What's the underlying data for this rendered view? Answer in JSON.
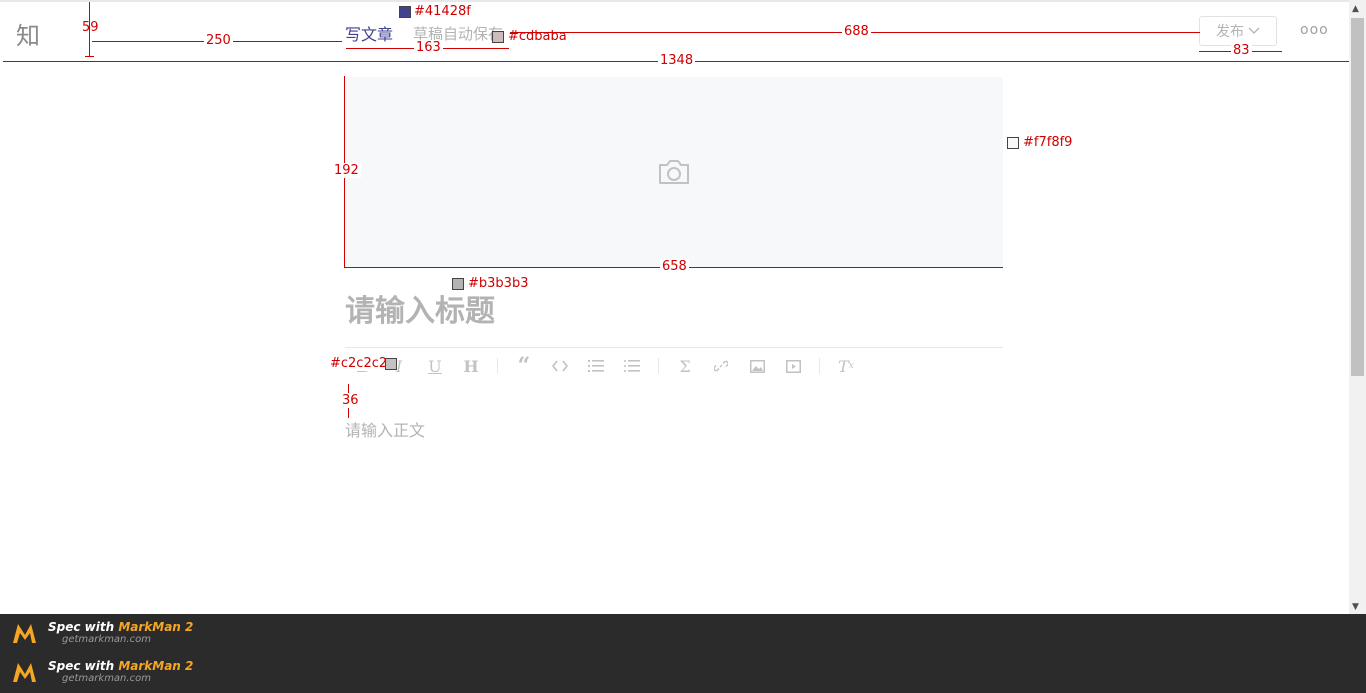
{
  "header": {
    "logo": "知",
    "write_label": "写文章",
    "draft_status": "草稿自动保存",
    "publish_label": "发布",
    "more_label": "ooo"
  },
  "editor": {
    "title_placeholder": "请输入标题",
    "body_placeholder": "请输入正文",
    "toolbar": [
      "bold-icon",
      "italic-icon",
      "underline-icon",
      "heading-icon",
      "quote-icon",
      "code-icon",
      "ordered-list-icon",
      "unordered-list-icon",
      "formula-icon",
      "link-icon",
      "image-icon",
      "video-icon",
      "clear-format-icon"
    ]
  },
  "annotations": {
    "color_title": "#41428f",
    "color_draft": "#cdbaba",
    "color_cover": "#f7f8f9",
    "color_placeholder": "#b3b3b3",
    "color_toolbar": "#c2c2c2",
    "dim_header_height": "59",
    "dim_logo_gap": "250",
    "dim_write_width": "163",
    "dim_publish_gap": "688",
    "dim_publish_width": "83",
    "dim_page_width": "1348",
    "dim_cover_height": "192",
    "dim_cover_width": "658",
    "dim_toolbar_gap": "36"
  },
  "footer": {
    "spec_prefix": "Spec with ",
    "brand": "MarkMan 2",
    "url": "getmarkman.com"
  }
}
